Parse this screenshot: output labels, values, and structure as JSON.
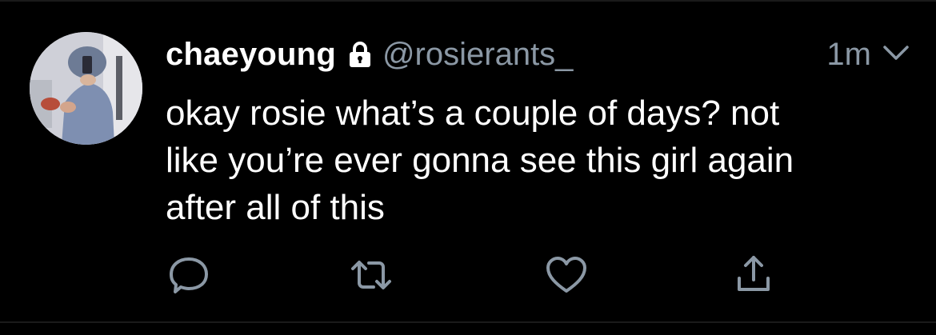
{
  "tweet": {
    "display_name": "chaeyoung",
    "handle": "@rosierants_",
    "time": "1m",
    "protected": true,
    "text": "okay rosie what’s a couple of days? not\nlike you’re ever gonna see this girl again\nafter all of this"
  },
  "actions": [
    {
      "name": "reply",
      "icon": "reply-icon"
    },
    {
      "name": "retweet",
      "icon": "retweet-icon"
    },
    {
      "name": "like",
      "icon": "heart-icon"
    },
    {
      "name": "share",
      "icon": "share-icon"
    }
  ],
  "colors": {
    "background": "#000000",
    "primary_text": "#ffffff",
    "secondary_text": "#8b98a5",
    "icon": "#8b98a5",
    "divider": "#1a1a1a"
  }
}
